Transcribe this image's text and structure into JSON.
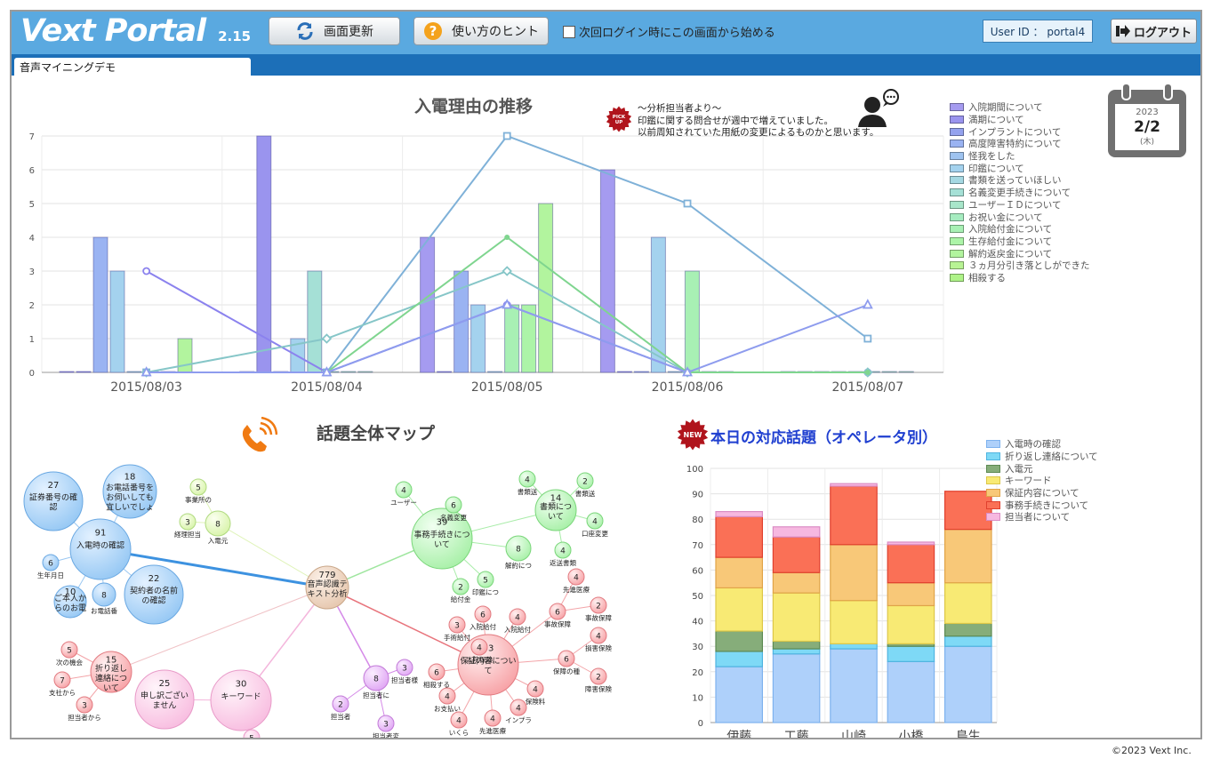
{
  "app": {
    "logo": "Vext Portal",
    "version": "2.15",
    "refresh_label": "画面更新",
    "hint_label": "使い方のヒント",
    "start_here_label": "次回ログイン時にこの画面から始める",
    "user_id": "User ID ： portal4",
    "logout_label": "ログアウト",
    "tab_label": "音声マイニングデモ",
    "copyright": "©2023 Vext Inc."
  },
  "calendar": {
    "year": "2023",
    "date": "2/2",
    "weekday": "(木)"
  },
  "analyst_note": {
    "badge": "PICK UP",
    "lines": [
      "～分析担当者より～",
      "印鑑に関する問合せが週中で増えていました。",
      "以前周知されていた用紙の変更によるものかと思います。"
    ]
  },
  "colors": {
    "topbar": "#5aa9e0",
    "tabbar": "#1c6fb8",
    "legend": [
      "#a59bf0",
      "#9a94ee",
      "#94a2ee",
      "#9ab3f2",
      "#9ec3f0",
      "#a4d2ee",
      "#a5d8e2",
      "#a5e0d6",
      "#a8e6ca",
      "#a6ecc0",
      "#a8f0b4",
      "#acf4a8",
      "#b2f49e",
      "#b8f394",
      "#aef388"
    ]
  },
  "chart_data": [
    {
      "type": "bar",
      "title": "入電理由の推移",
      "categories": [
        "2015/08/03",
        "2015/08/04",
        "2015/08/05",
        "2015/08/06",
        "2015/08/07"
      ],
      "ylim": [
        0,
        7
      ],
      "yticks": [
        "0",
        "1",
        "2",
        "3",
        "4",
        "5",
        "6",
        "7"
      ],
      "grid": true,
      "legend_position": "right",
      "legend": [
        "入院期間について",
        "満期について",
        "インプラントについて",
        "高度障害特約について",
        "怪我をした",
        "印鑑について",
        "書類を送っていほしい",
        "名義変更手続きについて",
        "ユーザーＩＤについて",
        "お祝い金について",
        "入院給付金について",
        "生存給付金について",
        "解約返戻金について",
        "３ヵ月分引き落としができた",
        "相殺する"
      ],
      "bar_groups": [
        [
          0,
          0,
          4,
          3,
          0,
          0,
          0,
          1
        ],
        [
          0,
          7,
          0,
          1,
          3,
          0,
          0,
          0
        ],
        [
          4,
          0,
          3,
          2,
          0,
          2,
          2,
          5
        ],
        [
          6,
          0,
          0,
          4,
          0,
          3,
          0,
          0
        ],
        [
          0,
          0,
          0,
          0,
          0,
          0,
          0,
          0
        ]
      ],
      "bar_color_index": [
        0,
        1,
        3,
        5,
        7,
        10,
        11,
        12
      ],
      "line_series": [
        {
          "marker": "circle",
          "color": "#8b82ee",
          "values": [
            3,
            0,
            2,
            0,
            0
          ]
        },
        {
          "marker": "square",
          "color": "#7fb1d8",
          "values": [
            0,
            0,
            7,
            5,
            1
          ]
        },
        {
          "marker": "diamond",
          "color": "#86c6c8",
          "values": [
            0,
            1,
            3,
            0,
            0
          ]
        },
        {
          "marker": "dot",
          "color": "#7fd58f",
          "values": [
            0,
            0,
            4,
            0,
            0
          ]
        },
        {
          "marker": "triangle",
          "color": "#8e9cee",
          "values": [
            0,
            0,
            2,
            0,
            2
          ]
        }
      ]
    },
    {
      "type": "bar",
      "stacked": true,
      "title": "本日の対応話題（オペレータ別）",
      "badge": "NEW",
      "categories": [
        "伊藤",
        "工藤",
        "山崎",
        "小橋",
        "鳥生"
      ],
      "ylim": [
        0,
        100
      ],
      "yticks": [
        "0",
        "10",
        "20",
        "30",
        "40",
        "50",
        "60",
        "70",
        "80",
        "90",
        "100"
      ],
      "legend_position": "top-right",
      "series": [
        {
          "name": "入電時の確認",
          "color": "#aed0fa",
          "stroke": "#7eb2ee",
          "values": [
            22,
            27,
            29,
            24,
            30
          ]
        },
        {
          "name": "折り返し連絡について",
          "color": "#7ed9f6",
          "stroke": "#4fb4e0",
          "values": [
            6,
            2,
            2,
            6,
            4
          ]
        },
        {
          "name": "入電元",
          "color": "#86ad7a",
          "stroke": "#5d8a53",
          "values": [
            8,
            3,
            0,
            1,
            5
          ]
        },
        {
          "name": "キーワード",
          "color": "#f8ea74",
          "stroke": "#ddc748",
          "values": [
            17,
            19,
            17,
            15,
            16
          ]
        },
        {
          "name": "保証内容について",
          "color": "#f8c878",
          "stroke": "#e0a448",
          "values": [
            12,
            8,
            22,
            9,
            21
          ]
        },
        {
          "name": "事務手続きについて",
          "color": "#fa7056",
          "stroke": "#e0402e",
          "values": [
            16,
            14,
            23,
            15,
            15
          ]
        },
        {
          "name": "担当者について",
          "color": "#f6b8e0",
          "stroke": "#da8cc4",
          "values": [
            2,
            4,
            1,
            1,
            0
          ]
        }
      ]
    }
  ],
  "topic_map": {
    "title": "話題全体マップ",
    "nodes": [
      {
        "id": "root",
        "count": "779",
        "label": "音声認識テキスト分析",
        "color": "brown"
      },
      {
        "id": "call_confirm",
        "count": "91",
        "label": "入電時の確認",
        "color": "blue"
      },
      {
        "id": "cert_no",
        "count": "27",
        "label": "証券番号の確認",
        "color": "blue"
      },
      {
        "id": "phone_ok",
        "count": "18",
        "label": "お電話番号をお伺いしても宜しいでしょうか",
        "color": "blue"
      },
      {
        "id": "contract_name",
        "count": "22",
        "label": "契約者の名前の確認",
        "color": "blue"
      },
      {
        "id": "birthday",
        "count": "6",
        "label": "生年月日",
        "color": "blue"
      },
      {
        "id": "from_person",
        "count": "10",
        "label": "ご本人からのお電",
        "color": "blue"
      },
      {
        "id": "phone_name",
        "count": "8",
        "label": "お電話番",
        "color": "blue"
      },
      {
        "id": "proc",
        "count": "39",
        "label": "事務手続きについて",
        "color": "green"
      },
      {
        "id": "docs",
        "count": "14",
        "label": "書類について",
        "color": "green"
      },
      {
        "id": "name_change",
        "count": "6",
        "label": "名義変更",
        "color": "green"
      },
      {
        "id": "user_g",
        "count": "4",
        "label": "ユーザー",
        "color": "green"
      },
      {
        "id": "cancel",
        "count": "8",
        "label": "解約につ",
        "color": "green"
      },
      {
        "id": "seal",
        "count": "5",
        "label": "印鑑につ",
        "color": "green"
      },
      {
        "id": "fee",
        "count": "2",
        "label": "給付金",
        "color": "green"
      },
      {
        "id": "caller",
        "count": "8",
        "label": "入電元",
        "color": "lightgreen"
      },
      {
        "id": "cg5",
        "count": "5",
        "label": "事業所の",
        "color": "lightgreen"
      },
      {
        "id": "cg3",
        "count": "3",
        "label": "経理担当",
        "color": "lightgreen"
      },
      {
        "id": "d4a",
        "count": "4",
        "label": "書類送",
        "color": "green"
      },
      {
        "id": "d2",
        "count": "2",
        "label": "書類送",
        "color": "green"
      },
      {
        "id": "d4b",
        "count": "4",
        "label": "口座変更",
        "color": "green"
      },
      {
        "id": "d4c",
        "count": "4",
        "label": "返送書類",
        "color": "green"
      },
      {
        "id": "guarantee",
        "count": "53",
        "label": "保証内容について",
        "color": "red"
      },
      {
        "id": "callback",
        "count": "15",
        "label": "折り返し連絡について",
        "color": "red"
      },
      {
        "id": "keyword",
        "count": "30",
        "label": "キーワード",
        "color": "pink"
      },
      {
        "id": "sorry",
        "count": "25",
        "label": "申し訳ございません",
        "color": "pink"
      },
      {
        "id": "rep",
        "count": "8",
        "label": "担当者に",
        "color": "violet"
      },
      {
        "id": "r3a",
        "count": "3",
        "label": "担当者様",
        "color": "violet"
      },
      {
        "id": "r2",
        "count": "2",
        "label": "担当者",
        "color": "violet"
      },
      {
        "id": "r3b",
        "count": "3",
        "label": "担当者変",
        "color": "violet"
      },
      {
        "id": "k5",
        "count": "5",
        "label": "少々お待",
        "color": "pink"
      },
      {
        "id": "cb5",
        "count": "5",
        "label": "次の機会",
        "color": "red"
      },
      {
        "id": "cb7",
        "count": "7",
        "label": "支社から",
        "color": "red"
      },
      {
        "id": "cb3",
        "count": "3",
        "label": "担当者から",
        "color": "red"
      },
      {
        "id": "g6a",
        "count": "6",
        "label": "入院給付",
        "color": "red"
      },
      {
        "id": "g3a",
        "count": "3",
        "label": "手術給付",
        "color": "red"
      },
      {
        "id": "g4a",
        "count": "4",
        "label": "入院給付",
        "color": "red"
      },
      {
        "id": "g4b",
        "count": "4",
        "label": "先進医療",
        "color": "red"
      },
      {
        "id": "g6b",
        "count": "6",
        "label": "事故保障",
        "color": "red"
      },
      {
        "id": "g2a",
        "count": "2",
        "label": "事故保障",
        "color": "red"
      },
      {
        "id": "g4c",
        "count": "4",
        "label": "損害保険",
        "color": "red"
      },
      {
        "id": "g6c",
        "count": "6",
        "label": "保障の種",
        "color": "red"
      },
      {
        "id": "g2b",
        "count": "2",
        "label": "障害保険",
        "color": "red"
      },
      {
        "id": "g6d",
        "count": "6",
        "label": "相殺する",
        "color": "red"
      },
      {
        "id": "g4d",
        "count": "4",
        "label": "保険料",
        "color": "red"
      },
      {
        "id": "g4e",
        "count": "4",
        "label": "お支払い",
        "color": "red"
      },
      {
        "id": "g4f",
        "count": "4",
        "label": "いくら",
        "color": "red"
      },
      {
        "id": "g4g",
        "count": "4",
        "label": "インプラ",
        "color": "red"
      },
      {
        "id": "g4h",
        "count": "4",
        "label": "先進医療",
        "color": "red"
      },
      {
        "id": "g4i",
        "count": "4",
        "label": "入院保険",
        "color": "red"
      }
    ]
  }
}
